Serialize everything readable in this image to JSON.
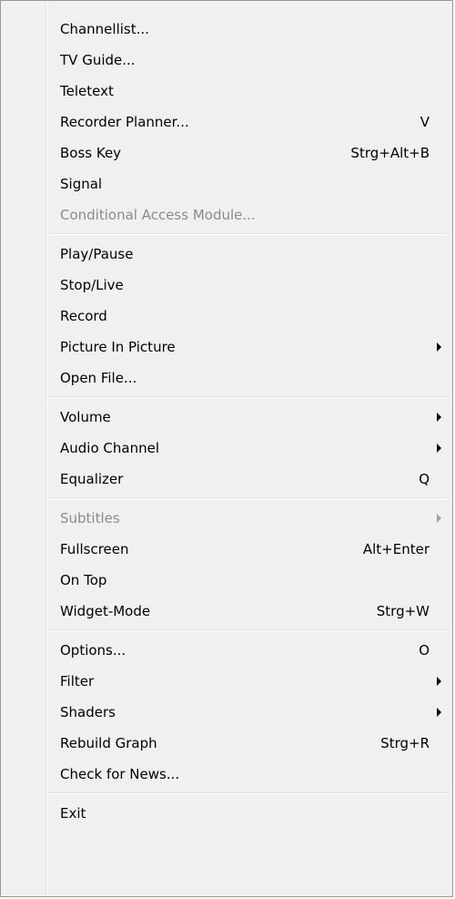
{
  "menu": {
    "groups": [
      {
        "items": [
          {
            "label": "Channellist...",
            "shortcut": "",
            "submenu": false,
            "enabled": true
          },
          {
            "label": "TV Guide...",
            "shortcut": "",
            "submenu": false,
            "enabled": true
          },
          {
            "label": "Teletext",
            "shortcut": "",
            "submenu": false,
            "enabled": true
          },
          {
            "label": "Recorder Planner...",
            "shortcut": "V",
            "submenu": false,
            "enabled": true
          },
          {
            "label": "Boss Key",
            "shortcut": "Strg+Alt+B",
            "submenu": false,
            "enabled": true
          },
          {
            "label": "Signal",
            "shortcut": "",
            "submenu": false,
            "enabled": true
          },
          {
            "label": "Conditional Access Module...",
            "shortcut": "",
            "submenu": false,
            "enabled": false
          }
        ]
      },
      {
        "items": [
          {
            "label": "Play/Pause",
            "shortcut": "",
            "submenu": false,
            "enabled": true
          },
          {
            "label": "Stop/Live",
            "shortcut": "",
            "submenu": false,
            "enabled": true
          },
          {
            "label": "Record",
            "shortcut": "",
            "submenu": false,
            "enabled": true
          },
          {
            "label": "Picture In Picture",
            "shortcut": "",
            "submenu": true,
            "enabled": true
          },
          {
            "label": "Open File...",
            "shortcut": "",
            "submenu": false,
            "enabled": true
          }
        ]
      },
      {
        "items": [
          {
            "label": "Volume",
            "shortcut": "",
            "submenu": true,
            "enabled": true
          },
          {
            "label": "Audio Channel",
            "shortcut": "",
            "submenu": true,
            "enabled": true
          },
          {
            "label": "Equalizer",
            "shortcut": "Q",
            "submenu": false,
            "enabled": true
          }
        ]
      },
      {
        "items": [
          {
            "label": "Subtitles",
            "shortcut": "",
            "submenu": true,
            "enabled": false
          },
          {
            "label": "Fullscreen",
            "shortcut": "Alt+Enter",
            "submenu": false,
            "enabled": true
          },
          {
            "label": "On Top",
            "shortcut": "",
            "submenu": false,
            "enabled": true
          },
          {
            "label": "Widget-Mode",
            "shortcut": "Strg+W",
            "submenu": false,
            "enabled": true
          }
        ]
      },
      {
        "items": [
          {
            "label": "Options...",
            "shortcut": "O",
            "submenu": false,
            "enabled": true
          },
          {
            "label": "Filter",
            "shortcut": "",
            "submenu": true,
            "enabled": true
          },
          {
            "label": "Shaders",
            "shortcut": "",
            "submenu": true,
            "enabled": true
          },
          {
            "label": "Rebuild Graph",
            "shortcut": "Strg+R",
            "submenu": false,
            "enabled": true
          },
          {
            "label": "Check for News...",
            "shortcut": "",
            "submenu": false,
            "enabled": true
          }
        ]
      },
      {
        "items": [
          {
            "label": "Exit",
            "shortcut": "",
            "submenu": false,
            "enabled": true
          }
        ]
      }
    ]
  },
  "colors": {
    "menu_background": "#f0f0f0",
    "menu_border": "#979797",
    "text": "#000000",
    "disabled_text": "#8b8b8b"
  }
}
